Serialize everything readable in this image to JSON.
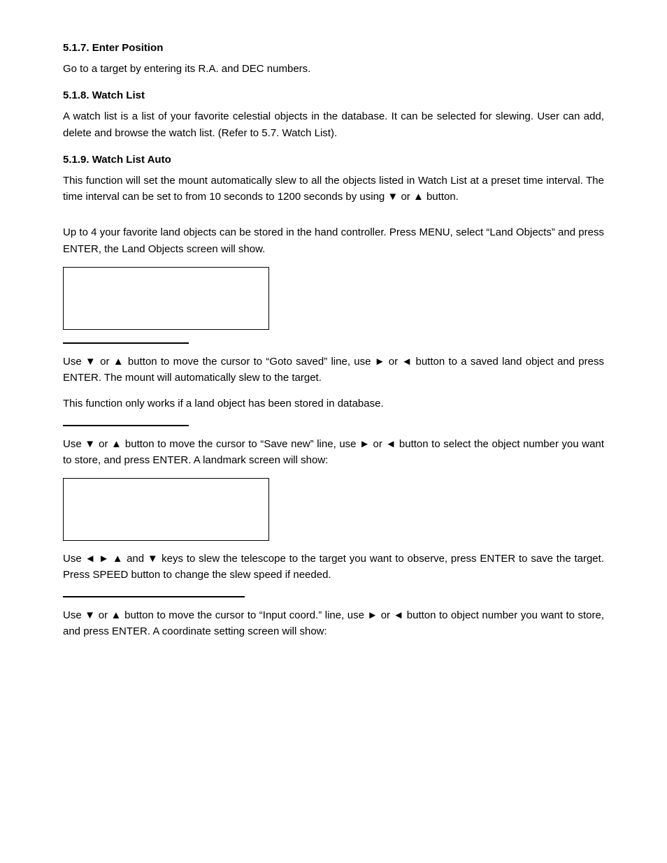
{
  "sections": [
    {
      "id": "517",
      "heading": "5.1.7. Enter Position",
      "paragraphs": [
        "Go to a target by entering its R.A. and DEC numbers."
      ]
    },
    {
      "id": "518",
      "heading": "5.1.8. Watch List",
      "paragraphs": [
        "A watch list is a list of your favorite celestial objects in the database. It can be selected for slewing. User can add, delete and browse the watch list. (Refer to 5.7. Watch List)."
      ]
    },
    {
      "id": "519",
      "heading": "5.1.9. Watch List Auto",
      "paragraphs": [
        "This function will set the mount automatically slew to all the objects listed in Watch List at a preset time interval. The time interval can be set to from 10 seconds to 1200 seconds by using ▼ or ▲ button."
      ]
    }
  ],
  "land_objects": {
    "intro_paragraph": "Up to 4 your favorite land objects can be stored in the hand controller. Press MENU, select “Land Objects” and press ENTER, the Land Objects screen will show.",
    "block1": {
      "description1": "Use ▼ or ▲ button to move the cursor to “Goto saved” line, use ► or ◄ button to a saved land object and press ENTER. The mount will automatically slew to the target.",
      "description2": "This function only works if a land object has been stored in database."
    },
    "block2": {
      "description1": "Use ▼ or ▲ button to move the cursor to “Save new” line, use ► or ◄ button to select the object number you want to store, and press ENTER. A landmark screen will show:"
    },
    "block3": {
      "description1": "Use ◄ ► ▲ and ▼ keys to slew the telescope to the target you want to observe, press ENTER to save the target. Press SPEED button to change the slew speed if needed."
    },
    "block4": {
      "description1": "Use ▼ or ▲ button to move the cursor to “Input coord.” line, use ► or ◄ button to object number you want to store, and press ENTER. A coordinate setting screen will show:"
    }
  }
}
